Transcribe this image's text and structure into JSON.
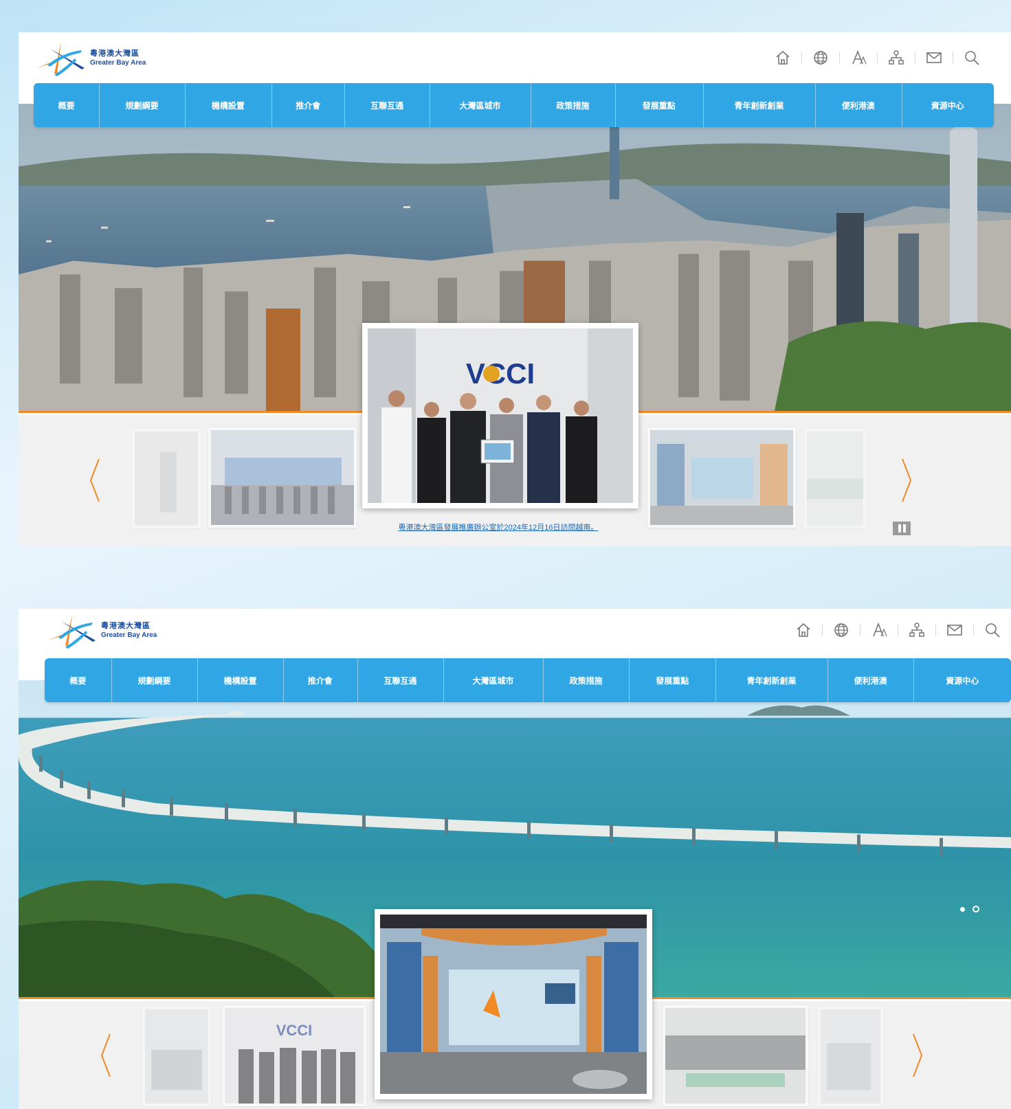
{
  "logo": {
    "name_cn": "粵港澳大灣區",
    "name_en": "Greater Bay Area"
  },
  "utility_icons": [
    "home-icon",
    "globe-icon",
    "text-size-icon",
    "sitemap-icon",
    "mail-icon",
    "search-icon"
  ],
  "nav": {
    "items": [
      "概要",
      "規劃綱要",
      "機構設置",
      "推介會",
      "互聯互通",
      "大灣區城市",
      "政策措施",
      "發展重點",
      "青年創新創業",
      "便利港澳",
      "資源中心"
    ]
  },
  "panels": [
    {
      "hero": {
        "theme": "victoria-harbour-skyline"
      },
      "featured": {
        "logo_text": "VCCI",
        "theme": "vcci-group-photo"
      },
      "caption": "粵港澳大灣區發展推廣辦公室於2024年12月16日訪問越南。",
      "pause_icon": "pause-icon"
    },
    {
      "hero": {
        "theme": "hong-kong-zhuhai-macao-bridge"
      },
      "featured": {
        "theme": "exhibition-booth"
      },
      "thumb_logo_text": "VCCI",
      "caption": "",
      "pause_icon": "pause-icon"
    }
  ],
  "colors": {
    "nav": "#30a7e4",
    "accent_orange": "#f08a24",
    "logo_blue": "#1e4f9c",
    "link": "#1a68b5"
  }
}
